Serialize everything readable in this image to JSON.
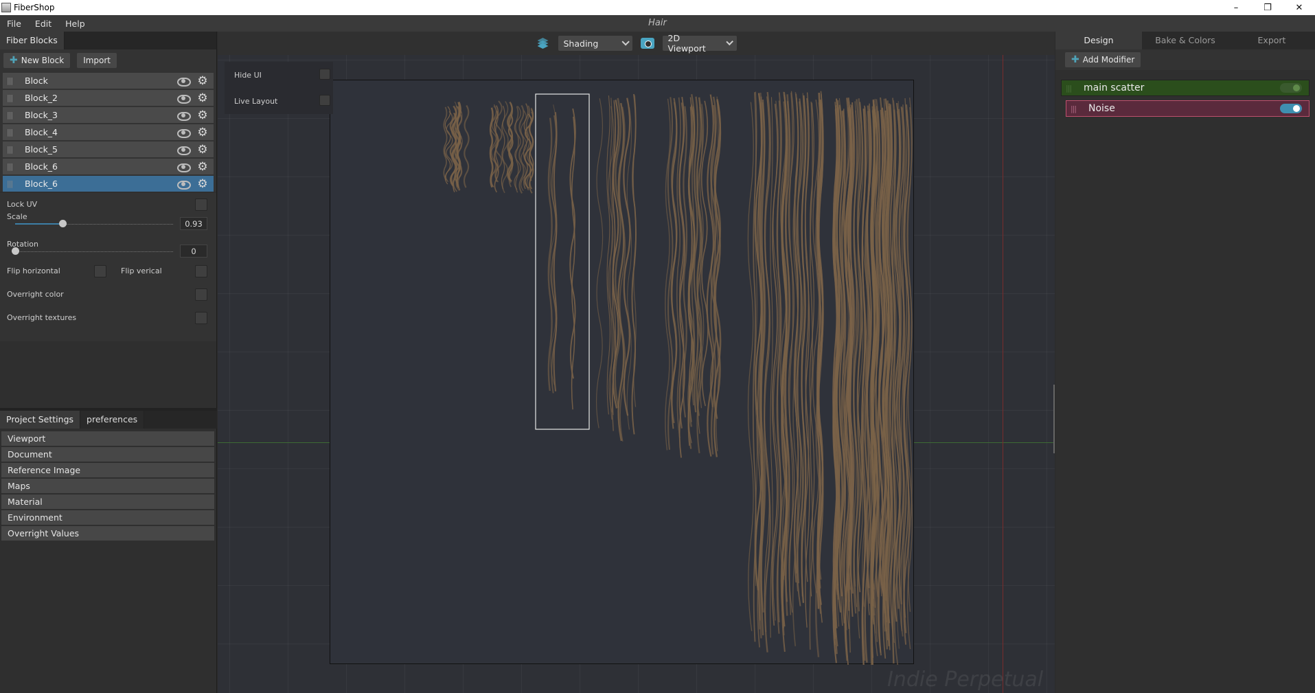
{
  "window": {
    "title": "FiberShop",
    "minimize": "–",
    "restore": "❐",
    "close": "✕"
  },
  "menu": {
    "file": "File",
    "edit": "Edit",
    "help": "Help",
    "document_title": "Hair"
  },
  "left_panel": {
    "tab": "Fiber Blocks",
    "new_block": "New Block",
    "import": "Import",
    "blocks": [
      "Block",
      "Block_2",
      "Block_3",
      "Block_4",
      "Block_5",
      "Block_6",
      "Block_6"
    ],
    "selected_index": 6,
    "props": {
      "lock_uv": "Lock UV",
      "scale_label": "Scale",
      "scale_value": "0.93",
      "scale_fraction": 0.3,
      "rotation_label": "Rotation",
      "rotation_value": "0",
      "rotation_fraction": 0.0,
      "flip_horizontal": "Flip horizontal",
      "flip_vertical": "Flip verical",
      "overright_color": "Overright color",
      "overright_textures": "Overright textures"
    },
    "bottom_tabs": {
      "project_settings": "Project Settings",
      "preferences": "preferences"
    },
    "sections": [
      "Viewport",
      "Document",
      "Reference Image",
      "Maps",
      "Material",
      "Environment",
      "Overright Values"
    ]
  },
  "viewport": {
    "shading": "Shading",
    "view_mode": "2D Viewport",
    "hide_ui": "Hide UI",
    "live_layout": "Live Layout",
    "watermark": "Indie Perpetual"
  },
  "right_panel": {
    "tabs": [
      "Design",
      "Bake & Colors",
      "Export"
    ],
    "add_modifier": "Add Modifier",
    "modifiers": {
      "main_scatter": "main scatter",
      "noise": "Noise"
    }
  },
  "colors": {
    "accent": "#3c6e96",
    "hair": "#7a6248",
    "scatter": "#2b4e1c",
    "noise": "#5a2a3c"
  }
}
